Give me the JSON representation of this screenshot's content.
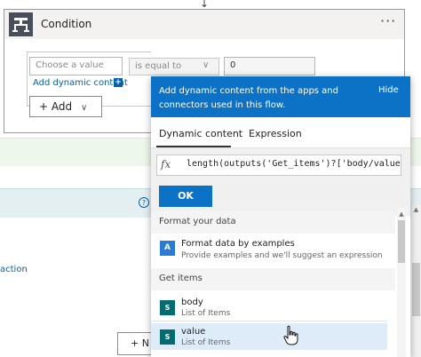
{
  "condition": {
    "title": "Condition",
    "more_label": "···",
    "left_placeholder": "Choose a value",
    "operator": "is equal to",
    "right_value": "0",
    "add_dynamic_link": "Add dynamic content",
    "add_dynamic_badge": "+",
    "add_button_label": "+ Add",
    "add_button_chevron": "∨"
  },
  "background": {
    "help_icon": "?",
    "action_link": "action",
    "new_button_label": "+ N"
  },
  "popup": {
    "header_text": "Add dynamic content from the apps and connectors used in this flow.",
    "hide_label": "Hide",
    "tabs": [
      {
        "label": "Dynamic content",
        "active": true
      },
      {
        "label": "Expression",
        "active": false
      }
    ],
    "fx_label": "fx",
    "expression": "length(outputs('Get_items')?['body/value'])",
    "ok_label": "OK",
    "sections": [
      {
        "title": "Format your data",
        "items": [
          {
            "icon": "format-data-icon",
            "icon_text": "A",
            "title": "Format data by examples",
            "description": "Provide examples and we'll suggest an expression"
          }
        ]
      },
      {
        "title": "Get items",
        "items": [
          {
            "icon": "sharepoint-icon",
            "icon_text": "S",
            "title": "body",
            "description": "List of Items"
          },
          {
            "icon": "sharepoint-icon",
            "icon_text": "S",
            "title": "value",
            "description": "List of Items",
            "hovered": true
          }
        ]
      }
    ]
  },
  "colors": {
    "accent": "#0b72c6",
    "link": "#0062ad",
    "hover_row": "#deecf9",
    "sharepoint": "#036c70"
  }
}
